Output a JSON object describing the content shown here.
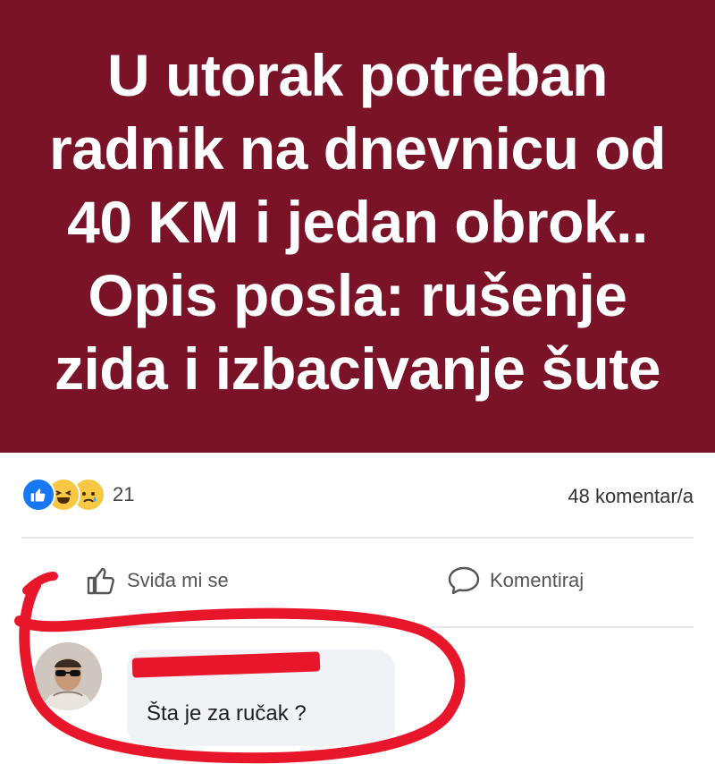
{
  "post": {
    "text_lines": [
      "U utorak potreban",
      "radnik na dnevnicu od",
      "40 KM i jedan obrok..",
      "Opis posla: rušenje",
      "zida i izbacivanje šute"
    ],
    "background_color": "#7a1228",
    "text_color": "#ffffff"
  },
  "stats": {
    "reactions": [
      "like-icon",
      "haha-icon",
      "sad-icon"
    ],
    "reaction_count": "21",
    "comments_count": "48 komentar/a"
  },
  "actions": {
    "like_label": "Sviđa mi se",
    "comment_label": "Komentiraj"
  },
  "comment": {
    "author": "",
    "text": "Šta je za ručak ?"
  },
  "colors": {
    "accent_blue": "#1877f2",
    "highlight_red": "#e8162a",
    "bubble_bg": "#f0f2f5"
  }
}
